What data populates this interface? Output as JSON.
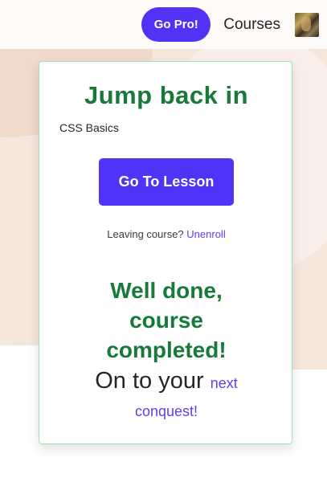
{
  "header": {
    "go_pro_label": "Go Pro!",
    "courses_label": "Courses"
  },
  "card": {
    "title": "Jump back in",
    "course_name": "CSS Basics",
    "lesson_button_label": "Go To Lesson",
    "leaving_text": "Leaving course?",
    "unenroll_label": "Unenroll",
    "done_line1": "Well done,",
    "done_line2": "course",
    "done_line3": "completed!",
    "onto_text": "On to your",
    "next_label": "next",
    "conquest_label": "conquest!"
  },
  "colors": {
    "accent": "#5233f5",
    "success_green": "#177a3a",
    "card_border": "#9de6b4",
    "beige_background": "#f6e7dd"
  }
}
